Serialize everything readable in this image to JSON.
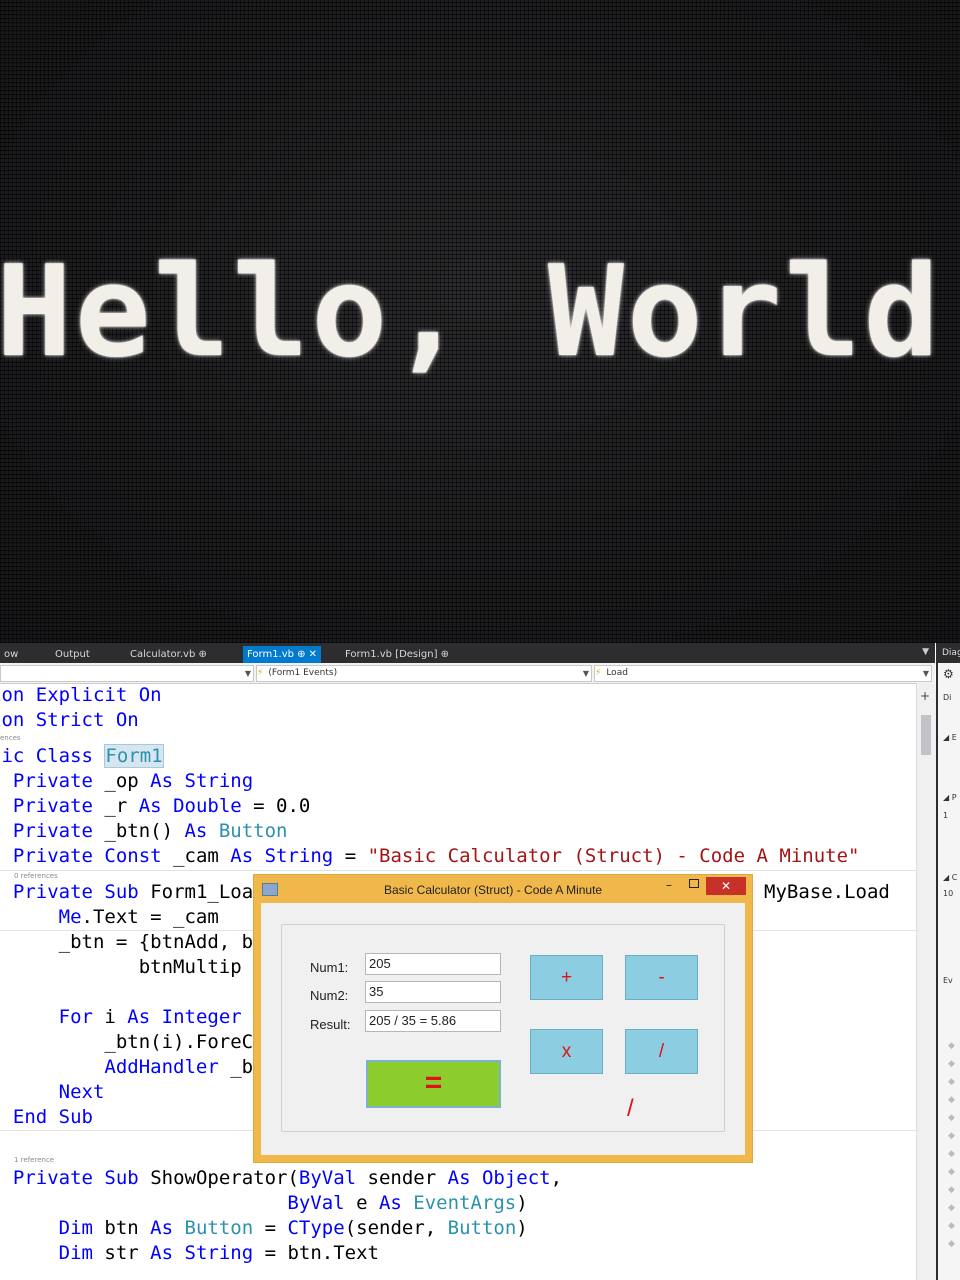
{
  "terminal": {
    "text": "Hello, World"
  },
  "ide": {
    "tabs": [
      "ow",
      "Output",
      "Calculator.vb ⊕",
      "Form1.vb ⊕",
      "Form1.vb [Design] ⊕"
    ],
    "active_tab_close": "✕",
    "nav": {
      "events": "(Form1 Events)",
      "member": "Load"
    },
    "code": {
      "l1": [
        "ion ",
        "Explicit On"
      ],
      "l2": [
        "ion ",
        "Strict On"
      ],
      "ref_refs": "ences",
      "l3": [
        "lic ",
        "Class ",
        "Form1"
      ],
      "l4": [
        "  ",
        "Private",
        " _op ",
        "As",
        " ",
        "String"
      ],
      "l5": [
        "  ",
        "Private",
        " _r ",
        "As",
        " ",
        "Double",
        " = 0.0"
      ],
      "l6": [
        "  ",
        "Private",
        " _btn() ",
        "As",
        " ",
        "Button"
      ],
      "l7": [
        "  ",
        "Private",
        " ",
        "Const",
        " _cam ",
        "As",
        " ",
        "String",
        " = ",
        "\"Basic Calculator (Struct) - Code A Minute\""
      ],
      "ref_0": "0 references",
      "l8": [
        "  ",
        "Private",
        " ",
        "Sub",
        " Form1_Loa"
      ],
      "l8_tail": "MyBase.Load",
      "l9": [
        "      ",
        "Me",
        ".Text = _cam"
      ],
      "l10": "      _btn = {btnAdd, b",
      "l11": "             btnMultip",
      "l12": [
        "      ",
        "For",
        " i ",
        "As",
        " ",
        "Integer"
      ],
      "l13": "          _btn(i).ForeC",
      "l14": [
        "          ",
        "AddHandler",
        " _b"
      ],
      "l15": [
        "      ",
        "Next"
      ],
      "l16": [
        "  ",
        "End",
        " ",
        "Sub"
      ],
      "ref_1": "1 reference",
      "l17": [
        "  ",
        "Private",
        " ",
        "Sub",
        " ShowOperator(",
        "ByVal",
        " sender ",
        "As",
        " ",
        "Object",
        ","
      ],
      "l18": [
        "                          ",
        "ByVal",
        " e ",
        "As",
        " ",
        "EventArgs",
        ")"
      ],
      "l19": [
        "      ",
        "Dim",
        " btn ",
        "As",
        " ",
        "Button",
        " = ",
        "CType",
        "(sender, ",
        "Button",
        ")"
      ],
      "l20": [
        "      ",
        "Dim",
        " str ",
        "As",
        " ",
        "String",
        " = btn.Text"
      ]
    },
    "diag": {
      "header": "Diag",
      "row1": "Di",
      "row2": "◢ E",
      "row3": "◢ P",
      "row4": "1",
      "row5": "◢ C",
      "row6": "10",
      "row7": "Ev"
    }
  },
  "calculator": {
    "title": "Basic Calculator (Struct) - Code A Minute",
    "min": "–",
    "close": "✕",
    "num1_label": "Num1:",
    "num1_value": "205",
    "num2_label": "Num2:",
    "num2_value": "35",
    "result_label": "Result:",
    "result_value": "205 / 35 = 5.86",
    "btn_add": "+",
    "btn_sub": "-",
    "btn_mul": "x",
    "btn_div": "/",
    "btn_eq": "=",
    "operator_display": "/"
  }
}
